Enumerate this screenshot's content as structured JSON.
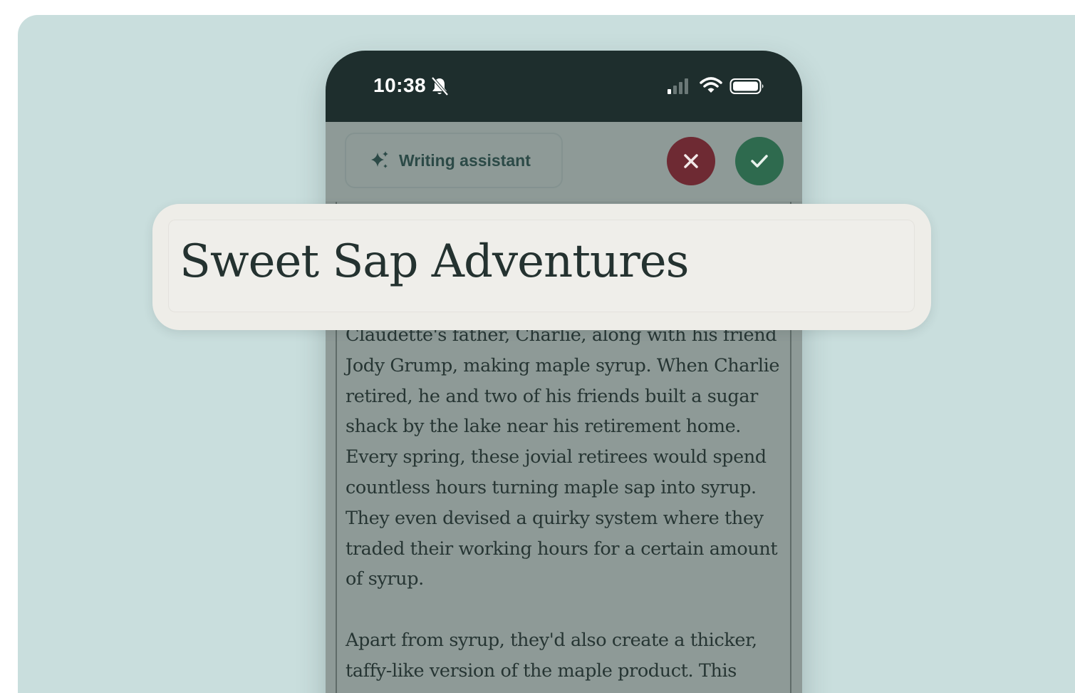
{
  "status_bar": {
    "time": "10:38",
    "icons": [
      "bell-slash-icon",
      "cellular-signal-icon",
      "wifi-icon",
      "battery-icon"
    ]
  },
  "toolbar": {
    "assistant_label": "Writing assistant",
    "assistant_icon": "sparkle-icon",
    "cancel_icon": "close-icon",
    "accept_icon": "checkmark-icon"
  },
  "document": {
    "title": "Sweet Sap Adventures",
    "paragraphs": [
      "Claudette's father, Charlie, along with his friend Jody Grump, making maple syrup. When Charlie retired, he and two of his friends built a sugar shack by the lake near his retirement home. Every spring, these jovial retirees would spend countless hours turning maple sap into syrup. They even devised a quirky system where they traded their working hours for a certain amount of syrup.",
      "Apart from syrup, they'd also create a thicker, taffy-like version of the maple product. This"
    ]
  },
  "colors": {
    "background": "#c9dedd",
    "status_bar": "#1e2e2d",
    "cancel": "#6e2a33",
    "accept": "#2e6a4e",
    "title_card": "#eeede8",
    "assistant_text": "#2c4a47"
  }
}
